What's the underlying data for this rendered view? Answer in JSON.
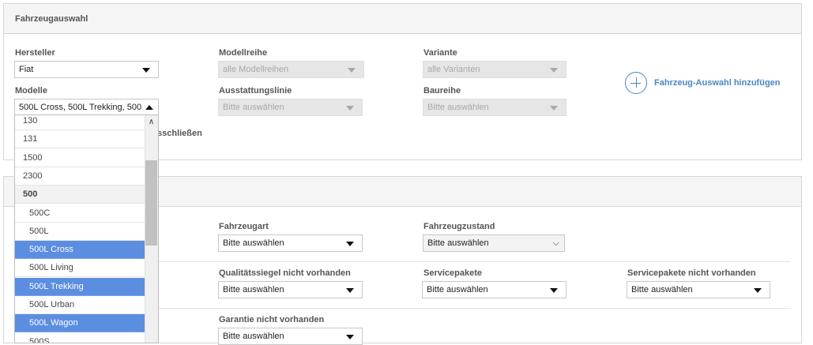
{
  "vehicle_panel": {
    "title": "Fahrzeugauswahl",
    "hersteller": {
      "label": "Hersteller",
      "value": "Fiat"
    },
    "modellreihe": {
      "label": "Modellreihe",
      "placeholder": "alle Modellreihen"
    },
    "variante": {
      "label": "Variante",
      "placeholder": "alle Varianten"
    },
    "modelle": {
      "label": "Modelle",
      "value": "500L Cross, 500L Trekking, 500"
    },
    "ausstattungslinie": {
      "label": "Ausstattungslinie",
      "placeholder": "Bitte auswählen"
    },
    "baureihe": {
      "label": "Baureihe",
      "placeholder": "Bitte auswählen"
    },
    "exclude_fragment": "sschließen",
    "add_button": "Fahrzeug-Auswahl hinzufügen"
  },
  "second_panel": {
    "fahrzeugart": {
      "label": "Fahrzeugart",
      "value": "Bitte auswählen"
    },
    "fahrzeugzustand": {
      "label": "Fahrzeugzustand",
      "value": "Bitte auswählen"
    },
    "qualitaetssiegel": {
      "label": "Qualitätssiegel nicht vorhanden",
      "value": "Bitte auswählen"
    },
    "servicepakete": {
      "label": "Servicepakete",
      "value": "Bitte auswählen"
    },
    "servicepakete_nicht": {
      "label": "Servicepakete nicht vorhanden",
      "value": "Bitte auswählen"
    },
    "garantie": {
      "label": "Garantie nicht vorhanden",
      "value": "Bitte auswählen"
    }
  },
  "model_dropdown": {
    "items": [
      {
        "label": "130",
        "selected": false
      },
      {
        "label": "131",
        "selected": false
      },
      {
        "label": "1500",
        "selected": false
      },
      {
        "label": "2300",
        "selected": false
      },
      {
        "label": "500",
        "group": true
      },
      {
        "label": "500C",
        "selected": false
      },
      {
        "label": "500L",
        "selected": false
      },
      {
        "label": "500L Cross",
        "selected": true
      },
      {
        "label": "500L Living",
        "selected": false
      },
      {
        "label": "500L Trekking",
        "selected": true
      },
      {
        "label": "500L Urban",
        "selected": false
      },
      {
        "label": "500L Wagon",
        "selected": true
      },
      {
        "label": "500S",
        "selected": false
      }
    ]
  },
  "colors": {
    "accent": "#4a86c5",
    "selected_row": "#5b8ee0"
  }
}
